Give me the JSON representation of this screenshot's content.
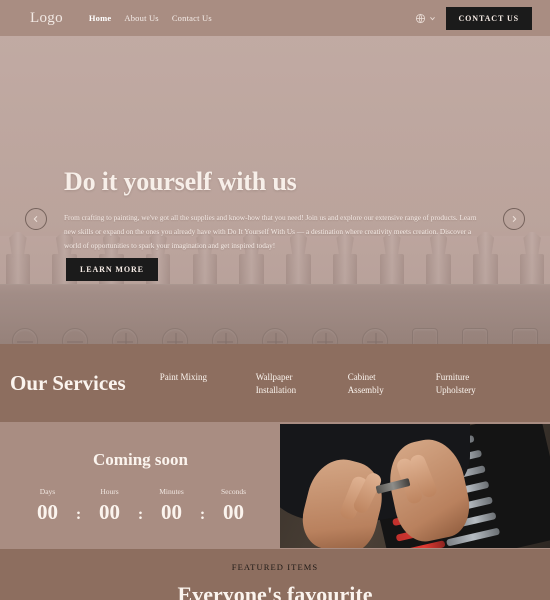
{
  "header": {
    "logo": "Logo",
    "nav": [
      {
        "label": "Home",
        "active": true
      },
      {
        "label": "About Us",
        "active": false
      },
      {
        "label": "Contact Us",
        "active": false
      }
    ],
    "language_icon": "globe-icon",
    "chevron_icon": "chevron-down-icon",
    "contact_button": "CONTACT US",
    "bg_color": "#a98d82"
  },
  "hero": {
    "title": "Do it yourself with us",
    "paragraph": "From crafting to painting, we've got all the supplies and know-how that you need! Join us and explore our extensive range of products. Learn new skills or expand on the ones you already have with Do It Yourself With Us — a destination where creativity meets creation. Discover a world of opportunities to spark your imagination and get inspired today!",
    "cta_label": "LEARN MORE",
    "prev_icon": "chevron-left-icon",
    "next_icon": "chevron-right-icon",
    "slides": 3,
    "active_slide": 1,
    "bg_color": "#c0a9a2"
  },
  "services": {
    "title": "Our Services",
    "items": [
      {
        "label": "Paint Mixing"
      },
      {
        "label": "Wallpaper\nInstallation"
      },
      {
        "label": "Cabinet\nAssembly"
      },
      {
        "label": "Furniture\nUpholstery"
      }
    ],
    "bg_color": "#8d6e5f"
  },
  "countdown": {
    "title": "Coming soon",
    "units": [
      {
        "label": "Days",
        "value": "00"
      },
      {
        "label": "Hours",
        "value": "00"
      },
      {
        "label": "Minutes",
        "value": "00"
      },
      {
        "label": "Seconds",
        "value": "00"
      }
    ],
    "separator": ":",
    "bg_color": "#a98d82",
    "image_alt": "hands-holding-drill-bit-over-toolset"
  },
  "featured": {
    "eyebrow": "FEATURED ITEMS",
    "title": "Everyone's favourite",
    "bg_color": "#8d6e5f"
  }
}
